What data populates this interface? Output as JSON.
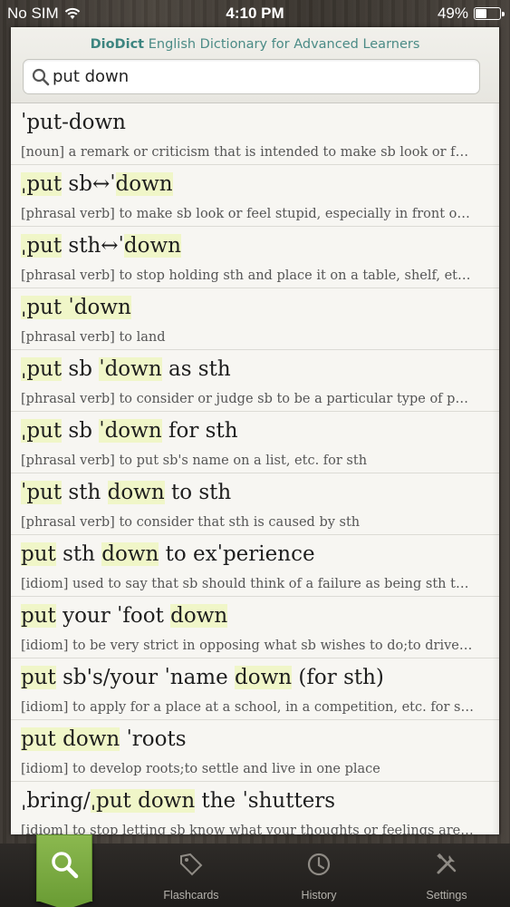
{
  "status": {
    "carrier": "No SIM",
    "time": "4:10 PM",
    "battery": "49%",
    "battery_level": 0.49
  },
  "header": {
    "brand": "DioDict",
    "title": "English Dictionary for Advanced Learners"
  },
  "search": {
    "value": "put down",
    "placeholder": ""
  },
  "results": [
    {
      "parts": [
        {
          "t": "ˈput-down",
          "h": false
        }
      ],
      "definition": "[noun] a remark or criticism that is intended to make sb look or feel..."
    },
    {
      "parts": [
        {
          "t": "ˌput",
          "h": true
        },
        {
          "t": " sb↔ˈ",
          "h": false
        },
        {
          "t": "down",
          "h": true
        }
      ],
      "definition": "[phrasal verb] to make sb look or feel stupid, especially in front of ot..."
    },
    {
      "parts": [
        {
          "t": "ˌput",
          "h": true
        },
        {
          "t": " sth↔ˈ",
          "h": false
        },
        {
          "t": "down",
          "h": true
        }
      ],
      "definition": "[phrasal verb] to stop holding sth and place it on a table, shelf, etc;to..."
    },
    {
      "parts": [
        {
          "t": "ˌput ˈdown",
          "h": true
        }
      ],
      "definition": "[phrasal verb] to land"
    },
    {
      "parts": [
        {
          "t": "ˌput",
          "h": true
        },
        {
          "t": " sb ",
          "h": false
        },
        {
          "t": "ˈdown",
          "h": true
        },
        {
          "t": " as sth",
          "h": false
        }
      ],
      "definition": "[phrasal verb] to consider or judge sb to be a particular type of person"
    },
    {
      "parts": [
        {
          "t": "ˌput",
          "h": true
        },
        {
          "t": " sb ",
          "h": false
        },
        {
          "t": "ˈdown",
          "h": true
        },
        {
          "t": " for sth",
          "h": false
        }
      ],
      "definition": "[phrasal verb] to put sb's name on a list, etc. for sth"
    },
    {
      "parts": [
        {
          "t": "ˈput",
          "h": true
        },
        {
          "t": " sth ",
          "h": false
        },
        {
          "t": "down",
          "h": true
        },
        {
          "t": " to sth",
          "h": false
        }
      ],
      "definition": "[phrasal verb] to consider that sth is caused by sth"
    },
    {
      "parts": [
        {
          "t": "put",
          "h": true
        },
        {
          "t": " sth ",
          "h": false
        },
        {
          "t": "down",
          "h": true
        },
        {
          "t": " to exˈperience",
          "h": false
        }
      ],
      "definition": "[idiom] used to say that sb should think of a failure as being sth that..."
    },
    {
      "parts": [
        {
          "t": "put",
          "h": true
        },
        {
          "t": " your ˈfoot ",
          "h": false
        },
        {
          "t": "down",
          "h": true
        }
      ],
      "definition": "[idiom] to be very strict in opposing what sb wishes to do;to drive fa..."
    },
    {
      "parts": [
        {
          "t": "put",
          "h": true
        },
        {
          "t": " sb's/your ˈname ",
          "h": false
        },
        {
          "t": "down",
          "h": true
        },
        {
          "t": " (for sth)",
          "h": false
        }
      ],
      "definition": "[idiom] to apply for a place at a school, in a competition, etc. for sb o..."
    },
    {
      "parts": [
        {
          "t": "put down",
          "h": true
        },
        {
          "t": " ˈroots",
          "h": false
        }
      ],
      "definition": "[idiom] to develop roots;to settle and live in one place"
    },
    {
      "parts": [
        {
          "t": "ˌbring/",
          "h": false
        },
        {
          "t": "ˌput down",
          "h": true
        },
        {
          "t": " the ˈshutters",
          "h": false
        }
      ],
      "definition": "[idiom] to stop letting sb know what your thoughts or feelings are; t..."
    }
  ],
  "tabs": {
    "search_icon": "search-icon",
    "flashcards": "Flashcards",
    "history": "History",
    "settings": "Settings"
  },
  "colors": {
    "highlight": "#f0f6c8",
    "accent_green": "#7aab41",
    "title_teal": "#4b8b86"
  }
}
